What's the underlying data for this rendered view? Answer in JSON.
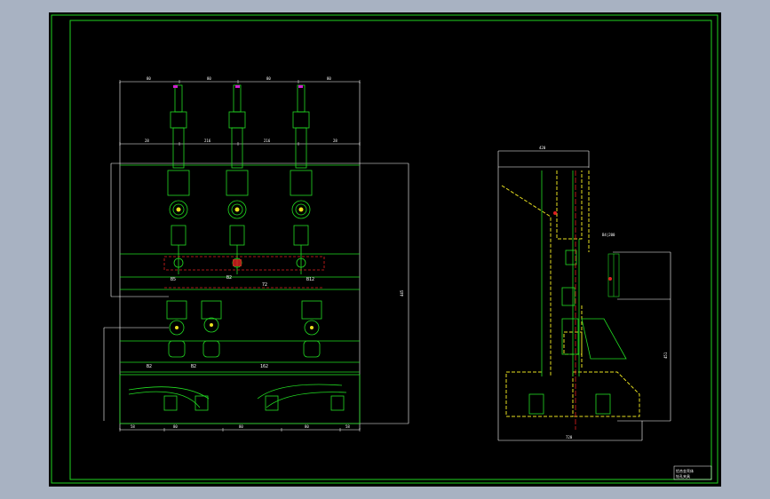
{
  "viewport": {
    "background": "#a8b2c2",
    "sheet_color": "#000000"
  },
  "colors": {
    "frame": "#1fd21f",
    "outline": "#ffffff",
    "green": "#22dd22",
    "yellow": "#e8e020",
    "red": "#e02020",
    "magenta": "#d020d0",
    "cyan": "#20d0d0"
  },
  "front_view": {
    "top_dims": [
      "80",
      "80",
      "80",
      "80"
    ],
    "mid_dims": [
      "28",
      "216",
      "216",
      "28"
    ],
    "bottom_dims": [
      "58",
      "80",
      "80",
      "80",
      "58"
    ],
    "side_total": "445",
    "labels": [
      "B5",
      "B2",
      "B12",
      "72",
      "B2",
      "162",
      "B2"
    ]
  },
  "side_view": {
    "top_dim": "420",
    "bottom_dim": "720",
    "right_dim": "451",
    "detail_label": "B4|200"
  },
  "title_block": {
    "line1": "铝合金壳体",
    "line2": "钻孔夹具"
  }
}
